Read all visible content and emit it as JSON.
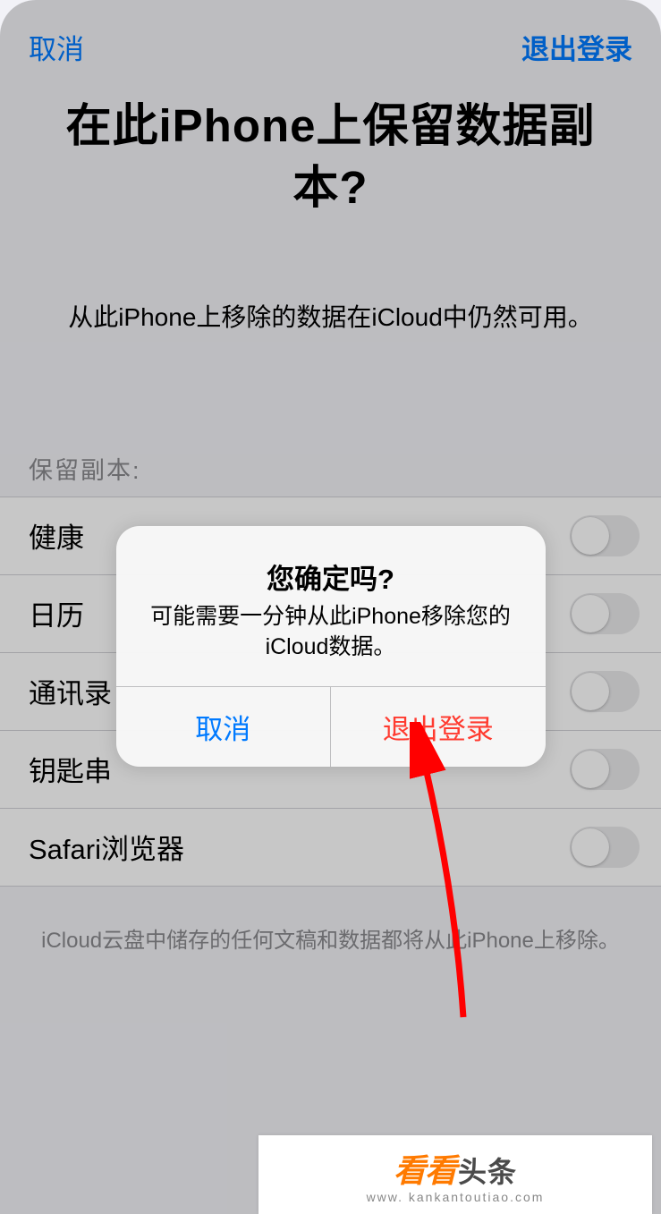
{
  "header": {
    "cancel": "取消",
    "signout": "退出登录"
  },
  "title": "在此iPhone上保留数据副本?",
  "subtitle": "从此iPhone上移除的数据在iCloud中仍然可用。",
  "section_header": "保留副本:",
  "items": [
    {
      "label": "健康",
      "on": false
    },
    {
      "label": "日历",
      "on": false
    },
    {
      "label": "通讯录",
      "on": false
    },
    {
      "label": "钥匙串",
      "on": false
    },
    {
      "label": "Safari浏览器",
      "on": false
    }
  ],
  "footer": "iCloud云盘中储存的任何文稿和数据都将从此iPhone上移除。",
  "alert": {
    "title": "您确定吗?",
    "message": "可能需要一分钟从此iPhone移除您的iCloud数据。",
    "cancel": "取消",
    "confirm": "退出登录"
  },
  "watermark": {
    "brand1": "看看",
    "brand2": "头条",
    "url": "www. kankantoutiao.com"
  }
}
